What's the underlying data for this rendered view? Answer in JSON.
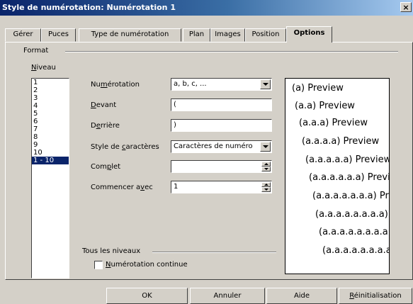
{
  "window": {
    "title": "Style de numérotation: Numérotation 1",
    "close_glyph": "×"
  },
  "tabs": [
    "Gérer",
    "Puces",
    "Type de numérotation",
    "Plan",
    "Images",
    "Position",
    "Options"
  ],
  "active_tab": "Options",
  "format": {
    "group_label": "Format",
    "niveau_label": "Niveau",
    "niveau_mnemonic": "N",
    "niveau_rest": "iveau",
    "levels": [
      "1",
      "2",
      "3",
      "4",
      "5",
      "6",
      "7",
      "8",
      "9",
      "10",
      "1 - 10"
    ],
    "selected_level": "1 - 10"
  },
  "fields": {
    "numerotation": {
      "label_pre": "Nu",
      "label_mn": "m",
      "label_post": "érotation",
      "value": "a, b, c, ..."
    },
    "devant": {
      "label_pre": "",
      "label_mn": "D",
      "label_post": "evant",
      "value": "("
    },
    "derriere": {
      "label_pre": "D",
      "label_mn": "e",
      "label_post": "rrière",
      "value": ")"
    },
    "style": {
      "label_pre": "Style de ",
      "label_mn": "c",
      "label_post": "aractères",
      "value": "Caractères de numéro"
    },
    "complet": {
      "label_pre": "Com",
      "label_mn": "p",
      "label_post": "let",
      "value": ""
    },
    "commencer": {
      "label_pre": "Commencer a",
      "label_mn": "v",
      "label_post": "ec",
      "value": "1"
    }
  },
  "preview_lines": [
    "(a) Preview",
    "(a.a) Preview",
    "(a.a.a) Preview",
    "(a.a.a.a) Preview",
    "(a.a.a.a.a) Preview",
    "(a.a.a.a.a.a) Preview",
    "(a.a.a.a.a.a.a) Preview",
    "(a.a.a.a.a.a.a.a) Preview",
    "(a.a.a.a.a.a.a.a.a) Preview",
    "(a.a.a.a.a.a.a.a.a.a) Preview"
  ],
  "tous_les_niveaux": {
    "group_label": "Tous les niveaux",
    "checkbox_mn": "N",
    "checkbox_rest": "umérotation continue",
    "checked": false
  },
  "buttons": {
    "ok": "OK",
    "annuler": "Annuler",
    "aide": "Aide",
    "reinit_mn": "R",
    "reinit_rest": "éinitialisation"
  }
}
